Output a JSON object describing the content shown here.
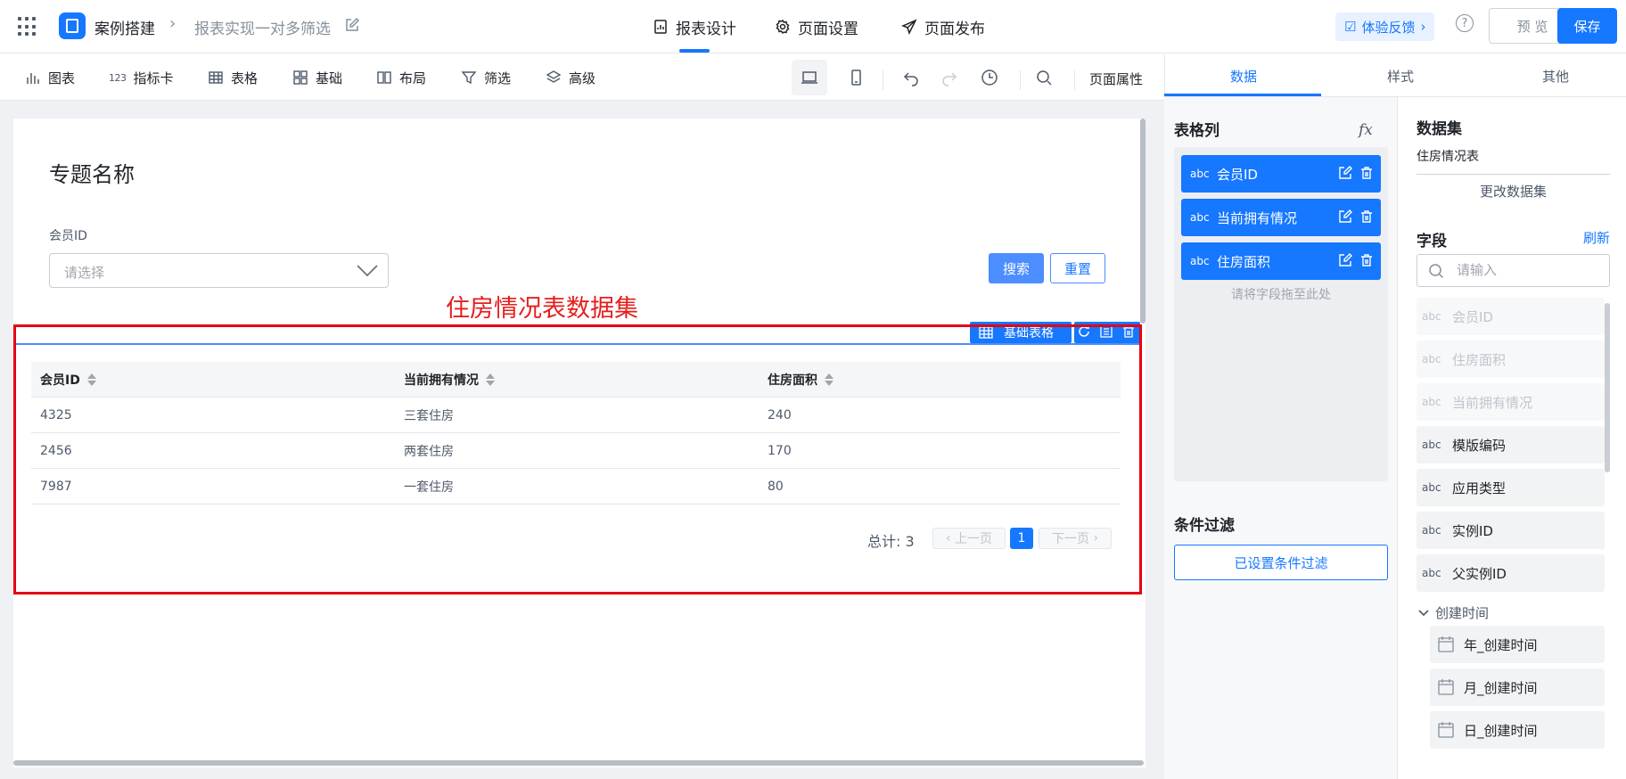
{
  "header": {
    "app_name": "案例搭建",
    "breadcrumb_sep": "›",
    "page_name": "报表实现一对多筛选",
    "tabs": [
      {
        "label": "报表设计",
        "icon": "report-design-icon"
      },
      {
        "label": "页面设置",
        "icon": "gear-icon"
      },
      {
        "label": "页面发布",
        "icon": "send-icon"
      }
    ],
    "feedback_label": "体验反馈",
    "help_label": "?",
    "preview_label": "预 览",
    "save_label": "保存"
  },
  "toolbar": {
    "items": [
      {
        "label": "图表",
        "icon": "chart-icon"
      },
      {
        "label": "指标卡",
        "icon": "number-123-icon",
        "icon_text": "123"
      },
      {
        "label": "表格",
        "icon": "table-icon"
      },
      {
        "label": "基础",
        "icon": "basic-grid-icon"
      },
      {
        "label": "布局",
        "icon": "layout-icon"
      },
      {
        "label": "筛选",
        "icon": "filter-icon"
      },
      {
        "label": "高级",
        "icon": "layers-icon"
      }
    ],
    "page_props_label": "页面属性"
  },
  "canvas": {
    "title": "专题名称",
    "filter": {
      "label": "会员ID",
      "placeholder": "请选择"
    },
    "search_label": "搜索",
    "reset_label": "重置",
    "annotation": "住房情况表数据集",
    "table_badge": "基础表格",
    "table": {
      "columns": [
        "会员ID",
        "当前拥有情况",
        "住房面积"
      ],
      "rows": [
        [
          "4325",
          "三套住房",
          "240"
        ],
        [
          "2456",
          "两套住房",
          "170"
        ],
        [
          "7987",
          "一套住房",
          "80"
        ]
      ]
    },
    "pagination": {
      "total": "总计: 3",
      "prev": "上一页",
      "current": "1",
      "next": "下一页"
    }
  },
  "panel": {
    "tabs": [
      "数据",
      "样式",
      "其他"
    ],
    "columns_title": "表格列",
    "fx_label": "fx",
    "table_columns": [
      {
        "type": "abc",
        "name": "会员ID"
      },
      {
        "type": "abc",
        "name": "当前拥有情况"
      },
      {
        "type": "abc",
        "name": "住房面积"
      }
    ],
    "drop_hint": "请将字段拖至此处",
    "condition_title": "条件过滤",
    "condition_button": "已设置条件过滤",
    "dataset_title": "数据集",
    "dataset_name": "住房情况表",
    "dataset_change": "更改数据集",
    "fields_title": "字段",
    "refresh_label": "刷新",
    "field_search_placeholder": "请输入",
    "fields": [
      {
        "type": "abc",
        "name": "会员ID",
        "used": true
      },
      {
        "type": "abc",
        "name": "住房面积",
        "used": true
      },
      {
        "type": "abc",
        "name": "当前拥有情况",
        "used": true
      },
      {
        "type": "abc",
        "name": "模版编码",
        "used": false
      },
      {
        "type": "abc",
        "name": "应用类型",
        "used": false
      },
      {
        "type": "abc",
        "name": "实例ID",
        "used": false
      },
      {
        "type": "abc",
        "name": "父实例ID",
        "used": false
      }
    ],
    "group_label": "创建时间",
    "date_fields": [
      "年_创建时间",
      "月_创建时间",
      "日_创建时间"
    ]
  },
  "colors": {
    "accent": "#1677ff",
    "annotation_red": "#e60012"
  }
}
